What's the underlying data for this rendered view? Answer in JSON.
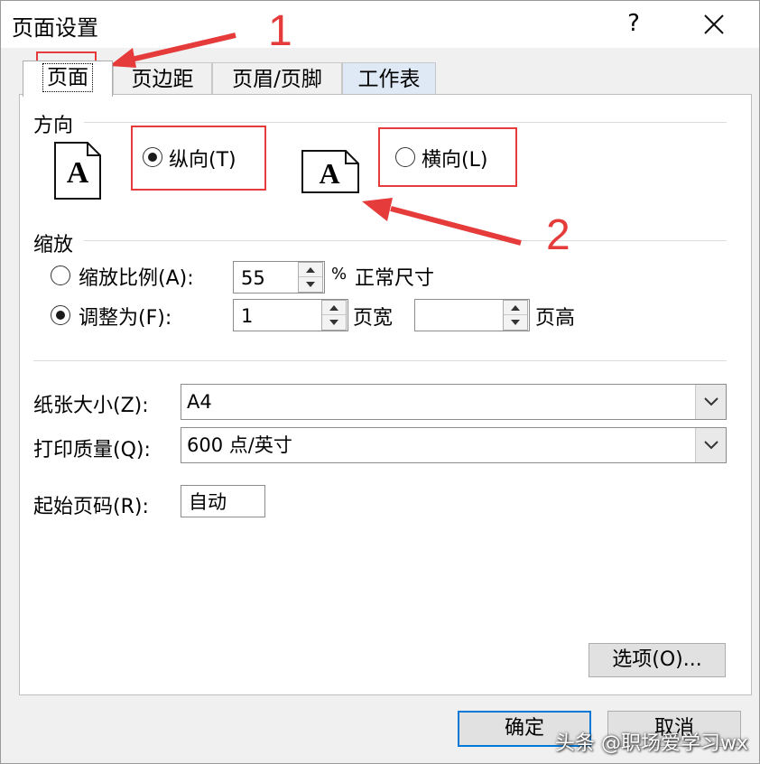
{
  "window": {
    "title": "页面设置",
    "help": "?"
  },
  "tabs": [
    {
      "label": "页面"
    },
    {
      "label": "页边距"
    },
    {
      "label": "页眉/页脚"
    },
    {
      "label": "工作表"
    }
  ],
  "orientation": {
    "section": "方向",
    "portrait": {
      "label": "纵向(T)",
      "selected": true
    },
    "landscape": {
      "label": "横向(L)",
      "selected": false
    },
    "icon_letter": "A"
  },
  "scaling": {
    "section": "缩放",
    "adjust_to": {
      "label": "缩放比例(A):",
      "value": "55",
      "suffix": "%",
      "after": "正常尺寸",
      "selected": false
    },
    "fit_to": {
      "label": "调整为(F):",
      "wide_value": "1",
      "wide_label": "页宽",
      "tall_value": "",
      "tall_label": "页高",
      "selected": true
    }
  },
  "paper_size": {
    "label": "纸张大小(Z):",
    "value": "A4"
  },
  "print_quality": {
    "label": "打印质量(Q):",
    "value": "600 点/英寸"
  },
  "first_page": {
    "label": "起始页码(R):",
    "value": "自动"
  },
  "options_button": "选项(O)...",
  "ok_button": "确定",
  "cancel_button": "取消",
  "annotations": {
    "one": "1",
    "two": "2",
    "color": "#e53b3b"
  },
  "watermark": "头条 @职场爱学习wx"
}
